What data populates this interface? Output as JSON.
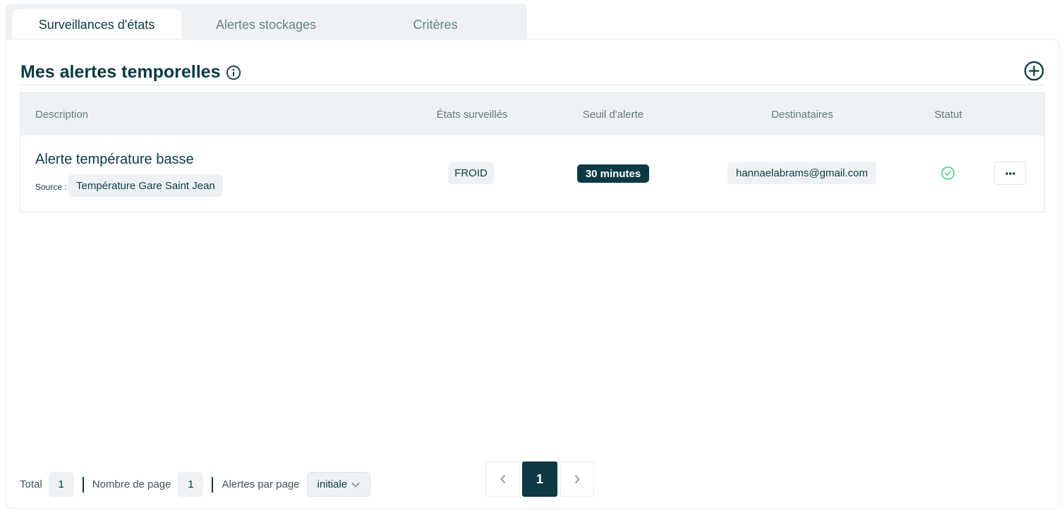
{
  "tabs": [
    {
      "label": "Surveillances d'états",
      "active": true
    },
    {
      "label": "Alertes stockages",
      "active": false
    },
    {
      "label": "Critères",
      "active": false
    }
  ],
  "section": {
    "title": "Mes alertes temporelles",
    "info_icon": "info-circle-icon",
    "add_icon": "plus-circle-icon"
  },
  "table": {
    "headers": {
      "description": "Description",
      "etats": "États surveillés",
      "seuil": "Seuil d'alerte",
      "destinataires": "Destinataires",
      "statut": "Statut"
    },
    "rows": [
      {
        "title": "Alerte température basse",
        "source_label": "Source :",
        "source": "Température Gare Saint Jean",
        "etat": "FROID",
        "seuil": "30 minutes",
        "destinataire": "hannaelabrams@gmail.com",
        "statut_icon": "check-circle-icon",
        "actions_icon": "more-horizontal-icon"
      }
    ]
  },
  "footer": {
    "total_label": "Total",
    "total_value": "1",
    "pages_label": "Nombre de page",
    "pages_value": "1",
    "per_page_label": "Alertes par page",
    "per_page_value": "initiale"
  },
  "pagination": {
    "current": "1"
  },
  "colors": {
    "primary": "#0b3a44",
    "chip_bg": "#eef2f5",
    "success": "#3ecf7a"
  }
}
